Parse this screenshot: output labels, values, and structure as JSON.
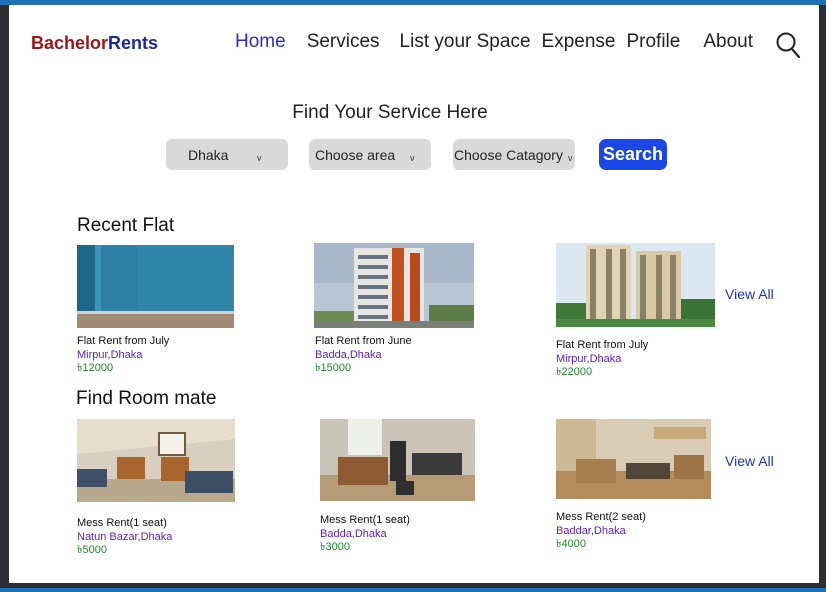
{
  "brand": {
    "part1": "Bachelor",
    "part2": "Rents"
  },
  "nav": [
    "Home",
    "Services",
    "List your Space",
    "Expense",
    "Profile",
    "About"
  ],
  "search": {
    "title": "Find Your Service Here",
    "city": "Dhaka",
    "area": "Choose area",
    "category": "Choose Catagory",
    "caret": "v",
    "button": "Search"
  },
  "recent_flat": {
    "title": "Recent Flat",
    "view_all": "View All",
    "items": [
      {
        "title": "Flat Rent from July",
        "location": "Mirpur,Dhaka",
        "price": "৳12000"
      },
      {
        "title": "Flat Rent from June",
        "location": "Badda,Dhaka",
        "price": "৳15000"
      },
      {
        "title": "Flat Rent from July",
        "location": "Mirpur,Dhaka",
        "price": "৳22000"
      }
    ]
  },
  "roommate": {
    "title": "Find Room mate",
    "view_all": "View All",
    "items": [
      {
        "title": "Mess Rent(1 seat)",
        "location": "Natun Bazar,Dhaka",
        "price": "৳5000"
      },
      {
        "title": "Mess Rent(1 seat)",
        "location": "Badda,Dhaka",
        "price": "৳3000"
      },
      {
        "title": "Mess Rent(2 seat)",
        "location": "Baddar,Dhaka",
        "price": "৳4000"
      }
    ]
  }
}
